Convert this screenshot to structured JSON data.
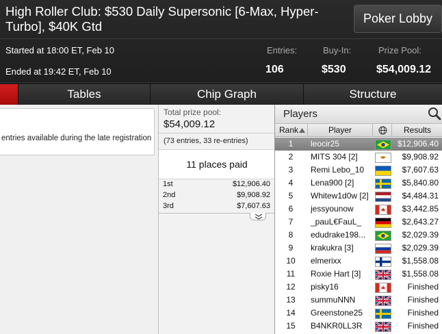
{
  "header": {
    "title": "High Roller Club: $530 Daily Supersonic [6-Max, Hyper-Turbo], $40K Gtd",
    "lobby_button": "Poker Lobby",
    "started": "Started at 18:00 ET, Feb 10",
    "ended": "Ended at 19:42 ET, Feb 10",
    "entries_label": "Entries:",
    "entries_value": "106",
    "buyin_label": "Buy-In:",
    "buyin_value": "$530",
    "prize_label": "Prize Pool:",
    "prize_value": "$54,009.12"
  },
  "tabs": {
    "tables": "Tables",
    "chip_graph": "Chip Graph",
    "structure": "Structure"
  },
  "info": {
    "text": "entries available during the late registration"
  },
  "prize": {
    "label": "Total prize pool:",
    "value": "$54,009.12",
    "entries_note": "(73 entries, 33 re-entries)",
    "places_paid": "11 places paid",
    "payouts": [
      {
        "place": "1st",
        "amount": "$12,906.40"
      },
      {
        "place": "2nd",
        "amount": "$9,908.92"
      },
      {
        "place": "3rd",
        "amount": "$7,607.63"
      }
    ]
  },
  "players": {
    "title": "Players",
    "columns": {
      "rank": "Rank",
      "player": "Player",
      "results": "Results"
    },
    "rows": [
      {
        "rank": "1",
        "name": "leocir25",
        "flag": "brazil",
        "result": "$12,906.40"
      },
      {
        "rank": "2",
        "name": "MITS 304 [2]",
        "flag": "cyprus",
        "result": "$9,908.92"
      },
      {
        "rank": "3",
        "name": "Remi Lebo_10",
        "flag": "ukraine",
        "result": "$7,607.63"
      },
      {
        "rank": "4",
        "name": "Lena900 [2]",
        "flag": "sweden",
        "result": "$5,840.80"
      },
      {
        "rank": "5",
        "name": "Whitew1d0w [2]",
        "flag": "netherlands",
        "result": "$4,484.31"
      },
      {
        "rank": "6",
        "name": "jessyounow",
        "flag": "canada",
        "result": "$3,442.85"
      },
      {
        "rank": "7",
        "name": "_pauL€FauL_",
        "flag": "germany",
        "result": "$2,643.27"
      },
      {
        "rank": "8",
        "name": "edudrake198...",
        "flag": "brazil",
        "result": "$2,029.39"
      },
      {
        "rank": "9",
        "name": "krakukra [3]",
        "flag": "russia",
        "result": "$2,029.39"
      },
      {
        "rank": "10",
        "name": "elmerixx",
        "flag": "finland",
        "result": "$1,558.08"
      },
      {
        "rank": "11",
        "name": "Roxie Hart [3]",
        "flag": "uk",
        "result": "$1,558.08"
      },
      {
        "rank": "12",
        "name": "pisky16",
        "flag": "canada",
        "result": "Finished"
      },
      {
        "rank": "13",
        "name": "summuNNN",
        "flag": "uk",
        "result": "Finished"
      },
      {
        "rank": "14",
        "name": "Greenstone25",
        "flag": "sweden",
        "result": "Finished"
      },
      {
        "rank": "15",
        "name": "B4NKR0LL3R",
        "flag": "uk",
        "result": "Finished"
      }
    ]
  },
  "colors": {
    "header_bg": "#222222",
    "tab_active_red": "#c41414",
    "selected_row": "#8a8a8a"
  }
}
